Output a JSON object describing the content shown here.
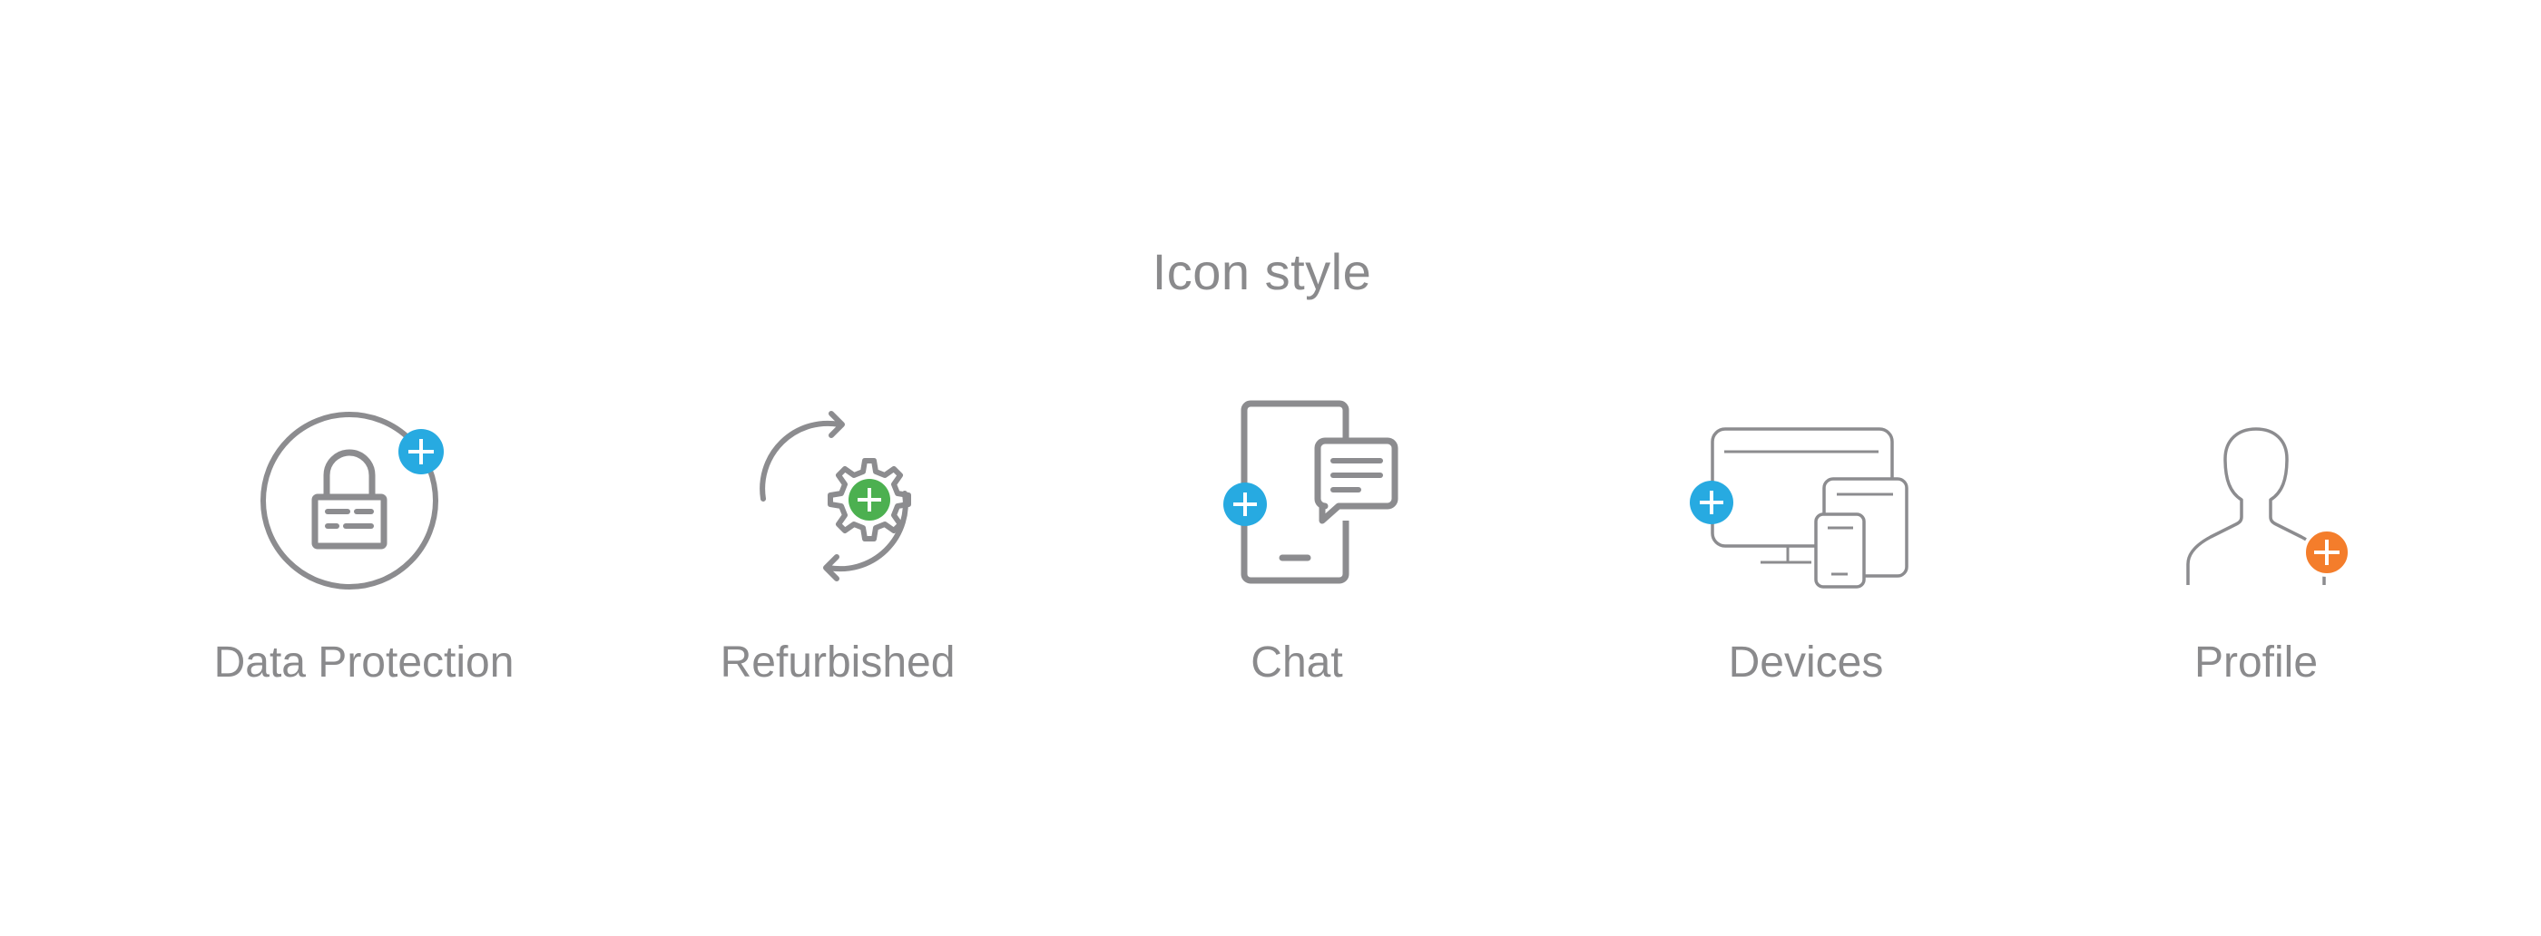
{
  "title": "Icon style",
  "colors": {
    "icon_stroke": "#8c8c8f",
    "text": "#8a8a8c",
    "badge_blue": "#27aae1",
    "badge_green": "#4cb050",
    "badge_orange": "#f47d2b"
  },
  "icons": [
    {
      "label": "Data Protection",
      "icon": "lock-icon",
      "badge": "plus-badge-blue"
    },
    {
      "label": "Refurbished",
      "icon": "gear-refresh-icon",
      "badge": "plus-badge-green"
    },
    {
      "label": "Chat",
      "icon": "phone-chat-icon",
      "badge": "plus-badge-blue"
    },
    {
      "label": "Devices",
      "icon": "devices-icon",
      "badge": "plus-badge-blue"
    },
    {
      "label": "Profile",
      "icon": "profile-icon",
      "badge": "plus-badge-orange"
    }
  ]
}
